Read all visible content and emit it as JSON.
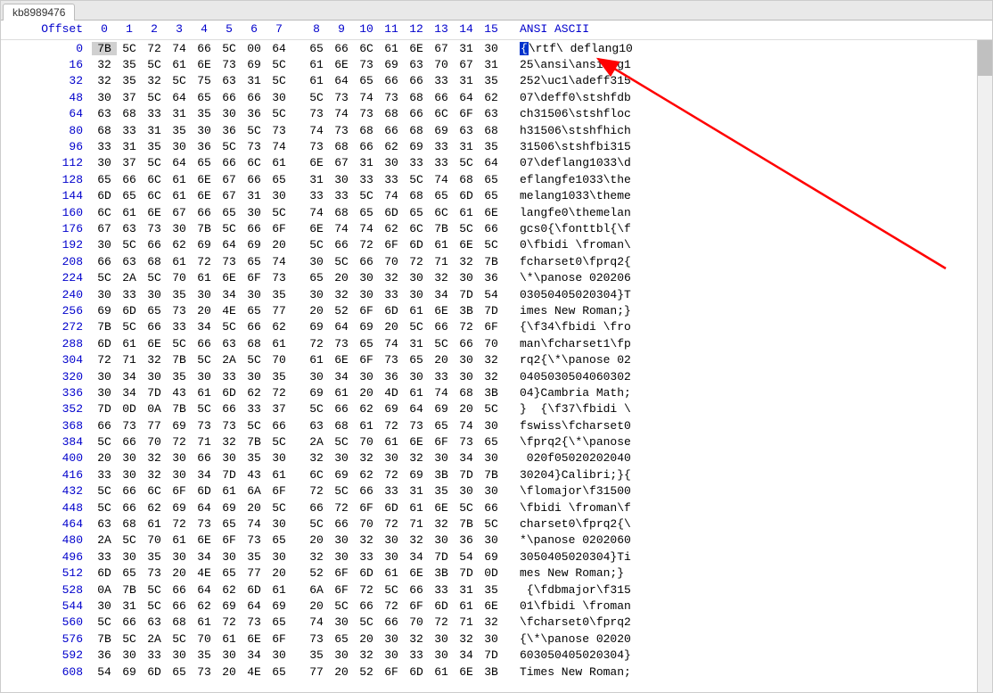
{
  "tab_label": "kb8989476",
  "offset_label": "Offset",
  "columns": [
    "0",
    "1",
    "2",
    "3",
    "4",
    "5",
    "6",
    "7",
    "8",
    "9",
    "10",
    "11",
    "12",
    "13",
    "14",
    "15"
  ],
  "ascii_label": "ANSI ASCII",
  "highlight_char": "{",
  "rows": [
    {
      "offset": "0",
      "hex": [
        "7B",
        "5C",
        "72",
        "74",
        "66",
        "5C",
        "00",
        "64",
        "65",
        "66",
        "6C",
        "61",
        "6E",
        "67",
        "31",
        "30"
      ],
      "ascii": "\\rtf\\ deflang10"
    },
    {
      "offset": "16",
      "hex": [
        "32",
        "35",
        "5C",
        "61",
        "6E",
        "73",
        "69",
        "5C",
        "61",
        "6E",
        "73",
        "69",
        "63",
        "70",
        "67",
        "31"
      ],
      "ascii": "25\\ansi\\ansicpg1"
    },
    {
      "offset": "32",
      "hex": [
        "32",
        "35",
        "32",
        "5C",
        "75",
        "63",
        "31",
        "5C",
        "61",
        "64",
        "65",
        "66",
        "66",
        "33",
        "31",
        "35"
      ],
      "ascii": "252\\uc1\\adeff315"
    },
    {
      "offset": "48",
      "hex": [
        "30",
        "37",
        "5C",
        "64",
        "65",
        "66",
        "66",
        "30",
        "5C",
        "73",
        "74",
        "73",
        "68",
        "66",
        "64",
        "62"
      ],
      "ascii": "07\\deff0\\stshfdb"
    },
    {
      "offset": "64",
      "hex": [
        "63",
        "68",
        "33",
        "31",
        "35",
        "30",
        "36",
        "5C",
        "73",
        "74",
        "73",
        "68",
        "66",
        "6C",
        "6F",
        "63"
      ],
      "ascii": "ch31506\\stshfloc"
    },
    {
      "offset": "80",
      "hex": [
        "68",
        "33",
        "31",
        "35",
        "30",
        "36",
        "5C",
        "73",
        "74",
        "73",
        "68",
        "66",
        "68",
        "69",
        "63",
        "68"
      ],
      "ascii": "h31506\\stshfhich"
    },
    {
      "offset": "96",
      "hex": [
        "33",
        "31",
        "35",
        "30",
        "36",
        "5C",
        "73",
        "74",
        "73",
        "68",
        "66",
        "62",
        "69",
        "33",
        "31",
        "35"
      ],
      "ascii": "31506\\stshfbi315"
    },
    {
      "offset": "112",
      "hex": [
        "30",
        "37",
        "5C",
        "64",
        "65",
        "66",
        "6C",
        "61",
        "6E",
        "67",
        "31",
        "30",
        "33",
        "33",
        "5C",
        "64"
      ],
      "ascii": "07\\deflang1033\\d"
    },
    {
      "offset": "128",
      "hex": [
        "65",
        "66",
        "6C",
        "61",
        "6E",
        "67",
        "66",
        "65",
        "31",
        "30",
        "33",
        "33",
        "5C",
        "74",
        "68",
        "65"
      ],
      "ascii": "eflangfe1033\\the"
    },
    {
      "offset": "144",
      "hex": [
        "6D",
        "65",
        "6C",
        "61",
        "6E",
        "67",
        "31",
        "30",
        "33",
        "33",
        "5C",
        "74",
        "68",
        "65",
        "6D",
        "65"
      ],
      "ascii": "melang1033\\theme"
    },
    {
      "offset": "160",
      "hex": [
        "6C",
        "61",
        "6E",
        "67",
        "66",
        "65",
        "30",
        "5C",
        "74",
        "68",
        "65",
        "6D",
        "65",
        "6C",
        "61",
        "6E"
      ],
      "ascii": "langfe0\\themelan"
    },
    {
      "offset": "176",
      "hex": [
        "67",
        "63",
        "73",
        "30",
        "7B",
        "5C",
        "66",
        "6F",
        "6E",
        "74",
        "74",
        "62",
        "6C",
        "7B",
        "5C",
        "66"
      ],
      "ascii": "gcs0{\\fonttbl{\\f"
    },
    {
      "offset": "192",
      "hex": [
        "30",
        "5C",
        "66",
        "62",
        "69",
        "64",
        "69",
        "20",
        "5C",
        "66",
        "72",
        "6F",
        "6D",
        "61",
        "6E",
        "5C"
      ],
      "ascii": "0\\fbidi \\froman\\"
    },
    {
      "offset": "208",
      "hex": [
        "66",
        "63",
        "68",
        "61",
        "72",
        "73",
        "65",
        "74",
        "30",
        "5C",
        "66",
        "70",
        "72",
        "71",
        "32",
        "7B"
      ],
      "ascii": "fcharset0\\fprq2{"
    },
    {
      "offset": "224",
      "hex": [
        "5C",
        "2A",
        "5C",
        "70",
        "61",
        "6E",
        "6F",
        "73",
        "65",
        "20",
        "30",
        "32",
        "30",
        "32",
        "30",
        "36"
      ],
      "ascii": "\\*\\panose 020206"
    },
    {
      "offset": "240",
      "hex": [
        "30",
        "33",
        "30",
        "35",
        "30",
        "34",
        "30",
        "35",
        "30",
        "32",
        "30",
        "33",
        "30",
        "34",
        "7D",
        "54"
      ],
      "ascii": "03050405020304}T"
    },
    {
      "offset": "256",
      "hex": [
        "69",
        "6D",
        "65",
        "73",
        "20",
        "4E",
        "65",
        "77",
        "20",
        "52",
        "6F",
        "6D",
        "61",
        "6E",
        "3B",
        "7D"
      ],
      "ascii": "imes New Roman;}"
    },
    {
      "offset": "272",
      "hex": [
        "7B",
        "5C",
        "66",
        "33",
        "34",
        "5C",
        "66",
        "62",
        "69",
        "64",
        "69",
        "20",
        "5C",
        "66",
        "72",
        "6F"
      ],
      "ascii": "{\\f34\\fbidi \\fro"
    },
    {
      "offset": "288",
      "hex": [
        "6D",
        "61",
        "6E",
        "5C",
        "66",
        "63",
        "68",
        "61",
        "72",
        "73",
        "65",
        "74",
        "31",
        "5C",
        "66",
        "70"
      ],
      "ascii": "man\\fcharset1\\fp"
    },
    {
      "offset": "304",
      "hex": [
        "72",
        "71",
        "32",
        "7B",
        "5C",
        "2A",
        "5C",
        "70",
        "61",
        "6E",
        "6F",
        "73",
        "65",
        "20",
        "30",
        "32"
      ],
      "ascii": "rq2{\\*\\panose 02"
    },
    {
      "offset": "320",
      "hex": [
        "30",
        "34",
        "30",
        "35",
        "30",
        "33",
        "30",
        "35",
        "30",
        "34",
        "30",
        "36",
        "30",
        "33",
        "30",
        "32"
      ],
      "ascii": "0405030504060302"
    },
    {
      "offset": "336",
      "hex": [
        "30",
        "34",
        "7D",
        "43",
        "61",
        "6D",
        "62",
        "72",
        "69",
        "61",
        "20",
        "4D",
        "61",
        "74",
        "68",
        "3B"
      ],
      "ascii": "04}Cambria Math;"
    },
    {
      "offset": "352",
      "hex": [
        "7D",
        "0D",
        "0A",
        "7B",
        "5C",
        "66",
        "33",
        "37",
        "5C",
        "66",
        "62",
        "69",
        "64",
        "69",
        "20",
        "5C"
      ],
      "ascii": "}  {\\f37\\fbidi \\"
    },
    {
      "offset": "368",
      "hex": [
        "66",
        "73",
        "77",
        "69",
        "73",
        "73",
        "5C",
        "66",
        "63",
        "68",
        "61",
        "72",
        "73",
        "65",
        "74",
        "30"
      ],
      "ascii": "fswiss\\fcharset0"
    },
    {
      "offset": "384",
      "hex": [
        "5C",
        "66",
        "70",
        "72",
        "71",
        "32",
        "7B",
        "5C",
        "2A",
        "5C",
        "70",
        "61",
        "6E",
        "6F",
        "73",
        "65"
      ],
      "ascii": "\\fprq2{\\*\\panose"
    },
    {
      "offset": "400",
      "hex": [
        "20",
        "30",
        "32",
        "30",
        "66",
        "30",
        "35",
        "30",
        "32",
        "30",
        "32",
        "30",
        "32",
        "30",
        "34",
        "30"
      ],
      "ascii": " 020f05020202040"
    },
    {
      "offset": "416",
      "hex": [
        "33",
        "30",
        "32",
        "30",
        "34",
        "7D",
        "43",
        "61",
        "6C",
        "69",
        "62",
        "72",
        "69",
        "3B",
        "7D",
        "7B"
      ],
      "ascii": "30204}Calibri;}{"
    },
    {
      "offset": "432",
      "hex": [
        "5C",
        "66",
        "6C",
        "6F",
        "6D",
        "61",
        "6A",
        "6F",
        "72",
        "5C",
        "66",
        "33",
        "31",
        "35",
        "30",
        "30"
      ],
      "ascii": "\\flomajor\\f31500"
    },
    {
      "offset": "448",
      "hex": [
        "5C",
        "66",
        "62",
        "69",
        "64",
        "69",
        "20",
        "5C",
        "66",
        "72",
        "6F",
        "6D",
        "61",
        "6E",
        "5C",
        "66"
      ],
      "ascii": "\\fbidi \\froman\\f"
    },
    {
      "offset": "464",
      "hex": [
        "63",
        "68",
        "61",
        "72",
        "73",
        "65",
        "74",
        "30",
        "5C",
        "66",
        "70",
        "72",
        "71",
        "32",
        "7B",
        "5C"
      ],
      "ascii": "charset0\\fprq2{\\"
    },
    {
      "offset": "480",
      "hex": [
        "2A",
        "5C",
        "70",
        "61",
        "6E",
        "6F",
        "73",
        "65",
        "20",
        "30",
        "32",
        "30",
        "32",
        "30",
        "36",
        "30"
      ],
      "ascii": "*\\panose 0202060"
    },
    {
      "offset": "496",
      "hex": [
        "33",
        "30",
        "35",
        "30",
        "34",
        "30",
        "35",
        "30",
        "32",
        "30",
        "33",
        "30",
        "34",
        "7D",
        "54",
        "69"
      ],
      "ascii": "3050405020304}Ti"
    },
    {
      "offset": "512",
      "hex": [
        "6D",
        "65",
        "73",
        "20",
        "4E",
        "65",
        "77",
        "20",
        "52",
        "6F",
        "6D",
        "61",
        "6E",
        "3B",
        "7D",
        "0D"
      ],
      "ascii": "mes New Roman;} "
    },
    {
      "offset": "528",
      "hex": [
        "0A",
        "7B",
        "5C",
        "66",
        "64",
        "62",
        "6D",
        "61",
        "6A",
        "6F",
        "72",
        "5C",
        "66",
        "33",
        "31",
        "35"
      ],
      "ascii": " {\\fdbmajor\\f315"
    },
    {
      "offset": "544",
      "hex": [
        "30",
        "31",
        "5C",
        "66",
        "62",
        "69",
        "64",
        "69",
        "20",
        "5C",
        "66",
        "72",
        "6F",
        "6D",
        "61",
        "6E"
      ],
      "ascii": "01\\fbidi \\froman"
    },
    {
      "offset": "560",
      "hex": [
        "5C",
        "66",
        "63",
        "68",
        "61",
        "72",
        "73",
        "65",
        "74",
        "30",
        "5C",
        "66",
        "70",
        "72",
        "71",
        "32"
      ],
      "ascii": "\\fcharset0\\fprq2"
    },
    {
      "offset": "576",
      "hex": [
        "7B",
        "5C",
        "2A",
        "5C",
        "70",
        "61",
        "6E",
        "6F",
        "73",
        "65",
        "20",
        "30",
        "32",
        "30",
        "32",
        "30"
      ],
      "ascii": "{\\*\\panose 02020"
    },
    {
      "offset": "592",
      "hex": [
        "36",
        "30",
        "33",
        "30",
        "35",
        "30",
        "34",
        "30",
        "35",
        "30",
        "32",
        "30",
        "33",
        "30",
        "34",
        "7D"
      ],
      "ascii": "603050405020304}"
    },
    {
      "offset": "608",
      "hex": [
        "54",
        "69",
        "6D",
        "65",
        "73",
        "20",
        "4E",
        "65",
        "77",
        "20",
        "52",
        "6F",
        "6D",
        "61",
        "6E",
        "3B"
      ],
      "ascii": "Times New Roman;"
    }
  ]
}
